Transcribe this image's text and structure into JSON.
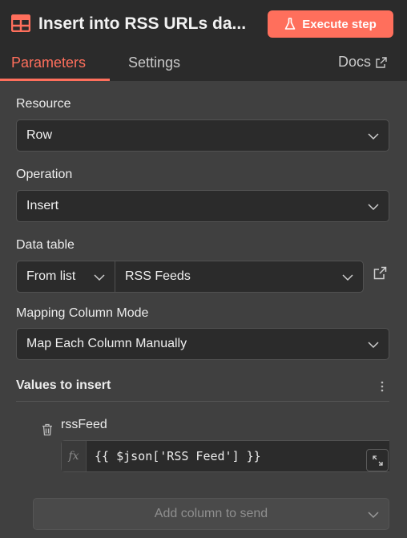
{
  "header": {
    "title": "Insert into RSS URLs da...",
    "node_icon": "table-icon",
    "execute_label": "Execute step",
    "execute_icon": "flask-icon",
    "accent_color": "#ff6f5c"
  },
  "tabs": [
    {
      "label": "Parameters",
      "active": true
    },
    {
      "label": "Settings",
      "active": false
    }
  ],
  "docs": {
    "label": "Docs",
    "icon": "external-link-icon"
  },
  "fields": {
    "resource": {
      "label": "Resource",
      "value": "Row"
    },
    "operation": {
      "label": "Operation",
      "value": "Insert"
    },
    "data_table": {
      "label": "Data table",
      "mode": "From list",
      "value": "RSS Feeds"
    },
    "mapping_mode": {
      "label": "Mapping Column Mode",
      "value": "Map Each Column Manually"
    }
  },
  "values_to_insert": {
    "title": "Values to insert",
    "columns": [
      {
        "name": "rssFeed",
        "fx_label": "fx",
        "expression": "{{ $json['RSS Feed'] }}"
      }
    ]
  },
  "add_column": {
    "label": "Add column to send"
  }
}
